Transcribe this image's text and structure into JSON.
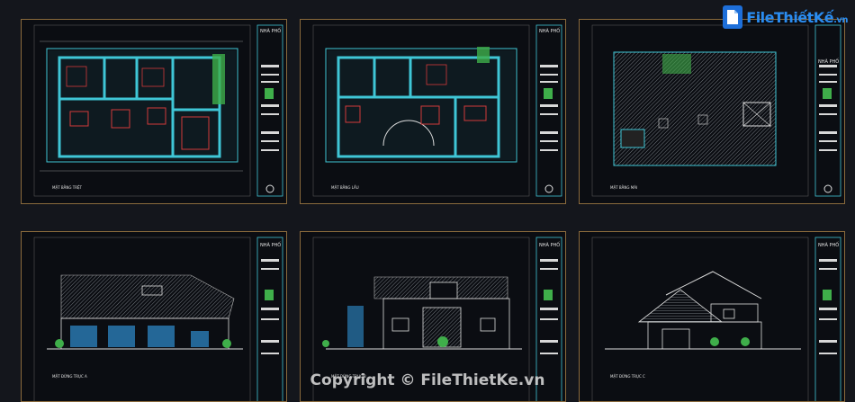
{
  "logo": {
    "text": "FileThiếtKế",
    "ext": ".vn"
  },
  "sheets": [
    {
      "title": "NHÀ PHỐ",
      "caption": "MẶT BẰNG TRỆT"
    },
    {
      "title": "NHÀ PHỐ",
      "caption": "MẶT BẰNG LẦU"
    },
    {
      "title": "NHÀ PHỐ",
      "caption": "MẶT BẰNG MÁI"
    },
    {
      "title": "NHÀ PHỐ",
      "caption": "MẶT ĐỨNG TRỤC A"
    },
    {
      "title": "NHÀ PHỐ",
      "caption": "MẶT ĐỨNG TRỤC B"
    },
    {
      "title": "NHÀ PHỐ",
      "caption": "MẶT ĐỨNG TRỤC C"
    }
  ],
  "watermark": "Copyright © FileThietKe.vn",
  "colors": {
    "wall": "#3fc6d6",
    "frame": "#8a6a3c",
    "green": "#3fae4a",
    "red": "#d23a3a",
    "bg": "#0b0d12"
  }
}
